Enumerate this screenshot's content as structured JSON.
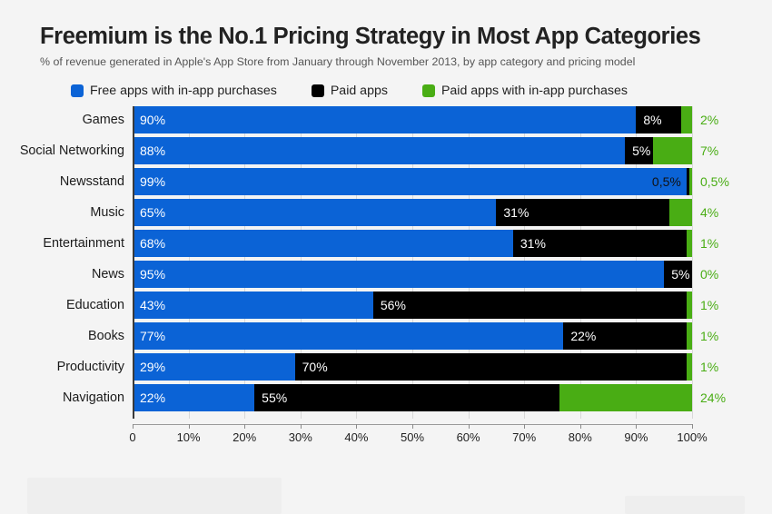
{
  "header": {
    "title": "Freemium is the No.1 Pricing Strategy in Most App Categories",
    "subtitle": "% of revenue generated in Apple's App Store from January through November 2013, by app category and pricing model"
  },
  "legend": {
    "items": [
      {
        "label": "Free apps with in-app purchases",
        "color": "#0b63d6",
        "swatch_name": "legend-swatch-free"
      },
      {
        "label": "Paid apps",
        "color": "#000000",
        "swatch_name": "legend-swatch-paid"
      },
      {
        "label": "Paid apps with in-app purchases",
        "color": "#49ad14",
        "swatch_name": "legend-swatch-paid-iap"
      }
    ]
  },
  "chart_data": {
    "type": "bar",
    "orientation": "horizontal",
    "stacked": true,
    "title": "Freemium is the No.1 Pricing Strategy in Most App Categories",
    "subtitle": "% of revenue generated in Apple's App Store from January through November 2013, by app category and pricing model",
    "xlabel": "",
    "ylabel": "",
    "xlim": [
      0,
      100
    ],
    "grid": true,
    "legend_position": "top",
    "xticks": [
      "0",
      "10%",
      "20%",
      "30%",
      "40%",
      "50%",
      "60%",
      "70%",
      "80%",
      "90%",
      "100%"
    ],
    "xtick_values": [
      0,
      10,
      20,
      30,
      40,
      50,
      60,
      70,
      80,
      90,
      100
    ],
    "categories": [
      "Games",
      "Social Networking",
      "Newsstand",
      "Music",
      "Entertainment",
      "News",
      "Education",
      "Books",
      "Productivity",
      "Navigation"
    ],
    "series": [
      {
        "name": "Free apps with in-app purchases",
        "color": "#0b63d6",
        "values": [
          90,
          88,
          99,
          65,
          68,
          95,
          43,
          77,
          29,
          22
        ],
        "labels": [
          "90%",
          "88%",
          "99%",
          "65%",
          "68%",
          "95%",
          "43%",
          "77%",
          "29%",
          "22%"
        ]
      },
      {
        "name": "Paid apps",
        "color": "#000000",
        "values": [
          8,
          5,
          0.5,
          31,
          31,
          5,
          56,
          22,
          70,
          55
        ],
        "labels": [
          "8%",
          "5%",
          "0,5%",
          "31%",
          "31%",
          "5%",
          "56%",
          "22%",
          "70%",
          "55%"
        ]
      },
      {
        "name": "Paid apps with in-app purchases",
        "color": "#49ad14",
        "values": [
          2,
          7,
          0.5,
          4,
          1,
          0,
          1,
          1,
          1,
          24
        ],
        "labels": [
          "2%",
          "7%",
          "0,5%",
          "4%",
          "1%",
          "0%",
          "1%",
          "1%",
          "1%",
          "24%"
        ]
      }
    ],
    "rows": [
      {
        "category": "Games",
        "free": 90,
        "free_label": "90%",
        "paid": 8,
        "paid_label": "8%",
        "paid_label_pos": "inside",
        "paid_iap": 2,
        "paid_iap_label": "2%"
      },
      {
        "category": "Social Networking",
        "free": 88,
        "free_label": "88%",
        "paid": 5,
        "paid_label": "5%",
        "paid_label_pos": "inside",
        "paid_iap": 7,
        "paid_iap_label": "7%"
      },
      {
        "category": "Newsstand",
        "free": 99,
        "free_label": "99%",
        "paid": 0.5,
        "paid_label": "0,5%",
        "paid_label_pos": "free-inside-right",
        "paid_iap": 0.5,
        "paid_iap_label": "0,5%"
      },
      {
        "category": "Music",
        "free": 65,
        "free_label": "65%",
        "paid": 31,
        "paid_label": "31%",
        "paid_label_pos": "inside",
        "paid_iap": 4,
        "paid_iap_label": "4%"
      },
      {
        "category": "Entertainment",
        "free": 68,
        "free_label": "68%",
        "paid": 31,
        "paid_label": "31%",
        "paid_label_pos": "inside",
        "paid_iap": 1,
        "paid_iap_label": "1%"
      },
      {
        "category": "News",
        "free": 95,
        "free_label": "95%",
        "paid": 5,
        "paid_label": "5%",
        "paid_label_pos": "inside",
        "paid_iap": 0,
        "paid_iap_label": "0%"
      },
      {
        "category": "Education",
        "free": 43,
        "free_label": "43%",
        "paid": 56,
        "paid_label": "56%",
        "paid_label_pos": "inside",
        "paid_iap": 1,
        "paid_iap_label": "1%"
      },
      {
        "category": "Books",
        "free": 77,
        "free_label": "77%",
        "paid": 22,
        "paid_label": "22%",
        "paid_label_pos": "inside",
        "paid_iap": 1,
        "paid_iap_label": "1%"
      },
      {
        "category": "Productivity",
        "free": 29,
        "free_label": "29%",
        "paid": 70,
        "paid_label": "70%",
        "paid_label_pos": "inside",
        "paid_iap": 1,
        "paid_iap_label": "1%"
      },
      {
        "category": "Navigation",
        "free": 22,
        "free_label": "22%",
        "paid": 55,
        "paid_label": "55%",
        "paid_label_pos": "inside",
        "paid_iap": 24,
        "paid_iap_label": "24%"
      }
    ]
  }
}
